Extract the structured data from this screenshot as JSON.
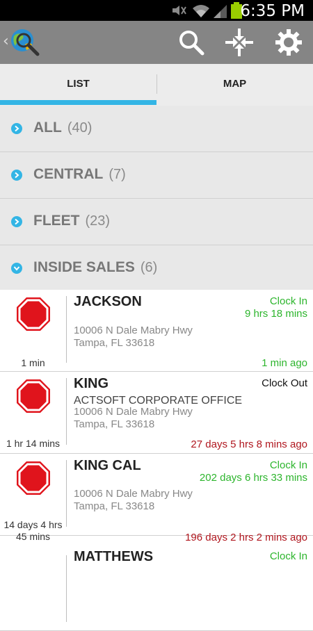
{
  "status_bar": {
    "time": "6:35 PM"
  },
  "tabs": [
    {
      "label": "LIST",
      "selected": true
    },
    {
      "label": "MAP",
      "selected": false
    }
  ],
  "groups": [
    {
      "name": "ALL",
      "count": "(40)",
      "expanded": false
    },
    {
      "name": "CENTRAL",
      "count": "(7)",
      "expanded": false
    },
    {
      "name": "FLEET",
      "count": "(23)",
      "expanded": false
    },
    {
      "name": "INSIDE SALES",
      "count": "(6)",
      "expanded": true
    }
  ],
  "employees": [
    {
      "name": "JACKSON",
      "company": "",
      "address_line1": "10006 N Dale Mabry Hwy",
      "address_line2": "Tampa, FL 33618",
      "status": "Clock In",
      "status_duration": "9 hrs 18 mins",
      "updated_ago": "1 min ago",
      "stop_duration_line1": "1 min",
      "stop_duration_line2": ""
    },
    {
      "name": "KING",
      "company": "ACTSOFT CORPORATE OFFICE",
      "address_line1": "10006 N Dale Mabry Hwy",
      "address_line2": "Tampa, FL 33618",
      "status": "Clock Out",
      "status_duration": "",
      "updated_ago": "27 days 5 hrs 8 mins ago",
      "stop_duration_line1": "1 hr 14 mins",
      "stop_duration_line2": ""
    },
    {
      "name": "KING CAL",
      "company": "",
      "address_line1": "10006 N Dale Mabry Hwy",
      "address_line2": "Tampa, FL 33618",
      "status": "Clock In",
      "status_duration": "202 days 6 hrs 33 mins",
      "updated_ago": "196 days 2 hrs 2 mins ago",
      "stop_duration_line1": "14 days 4 hrs",
      "stop_duration_line2": "45 mins"
    },
    {
      "name": "MATTHEWS",
      "status": "Clock In"
    }
  ],
  "colors": {
    "accent": "#33b5e5",
    "clock_in": "#2db52d",
    "stale": "#b0161e",
    "stop": "#e0141c"
  }
}
